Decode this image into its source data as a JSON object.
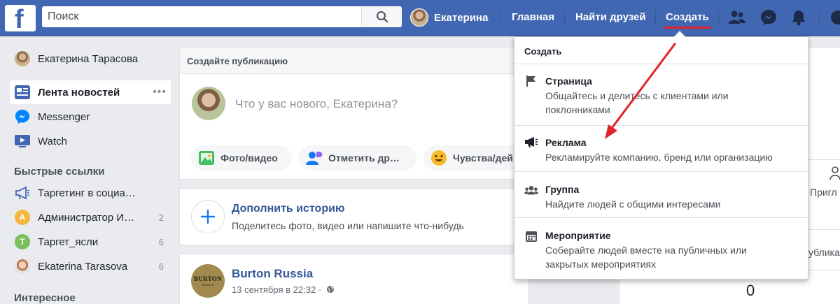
{
  "header": {
    "logo": "f",
    "search_placeholder": "Поиск",
    "user_name": "Екатерина",
    "links": {
      "home": "Главная",
      "find_friends": "Найти друзей",
      "create": "Создать"
    },
    "icons": [
      "friend-requests-icon",
      "messenger-icon",
      "notifications-icon"
    ],
    "accent_color": "#4267b2",
    "highlight_color": "#e0232a"
  },
  "sidebar": {
    "profile_name": "Екатерина Тарасова",
    "main_items": [
      {
        "label": "Лента новостей",
        "icon": "news-feed-icon",
        "dots": "•••"
      },
      {
        "label": "Messenger",
        "icon": "messenger-icon"
      },
      {
        "label": "Watch",
        "icon": "watch-icon"
      }
    ],
    "shortcuts_heading": "Быстрые ссылки",
    "shortcuts": [
      {
        "label": "Таргетинг в социа…",
        "icon": "megaphone-icon",
        "count": ""
      },
      {
        "label": "Администратор И…",
        "avatar_letter": "A",
        "count": "2"
      },
      {
        "label": "Таргет_ясли",
        "avatar_letter": "T",
        "count": "6"
      },
      {
        "label": "Ekaterina Tarasova",
        "icon": "avatar",
        "count": "6"
      }
    ],
    "explore_heading": "Интересное"
  },
  "composer": {
    "header": "Создайте публикацию",
    "prompt": "Что у вас нового, Екатерина?",
    "actions": [
      {
        "label": "Фото/видео",
        "icon": "photo-icon"
      },
      {
        "label": "Отметить др…",
        "icon": "tag-friends-icon"
      },
      {
        "label": "Чувства/дей",
        "icon": "feeling-icon"
      }
    ]
  },
  "story": {
    "title": "Дополнить историю",
    "subtitle": "Поделитесь фото, видео или напишите что-нибудь"
  },
  "post": {
    "page_name": "Burton Russia",
    "timestamp": "13 сентября в 22:32 ·",
    "logo_text": "BURTON",
    "logo_sub": "RUSSIA"
  },
  "right_column": {
    "invite_text": "Пригл",
    "publish_text": "убликац",
    "count": "0"
  },
  "create_menu": {
    "title": "Создать",
    "items": [
      {
        "title": "Страница",
        "description": "Общайтесь и делитесь с клиентами или поклонниками",
        "icon": "flag-icon"
      },
      {
        "title": "Реклама",
        "description": "Рекламируйте компанию, бренд или организацию",
        "icon": "megaphone-icon"
      },
      {
        "title": "Группа",
        "description": "Найдите людей с общими интересами",
        "icon": "group-icon"
      },
      {
        "title": "Мероприятие",
        "description": "Соберайте людей вместе на публичных или закрытых мероприятиях",
        "icon": "calendar-icon"
      }
    ]
  }
}
